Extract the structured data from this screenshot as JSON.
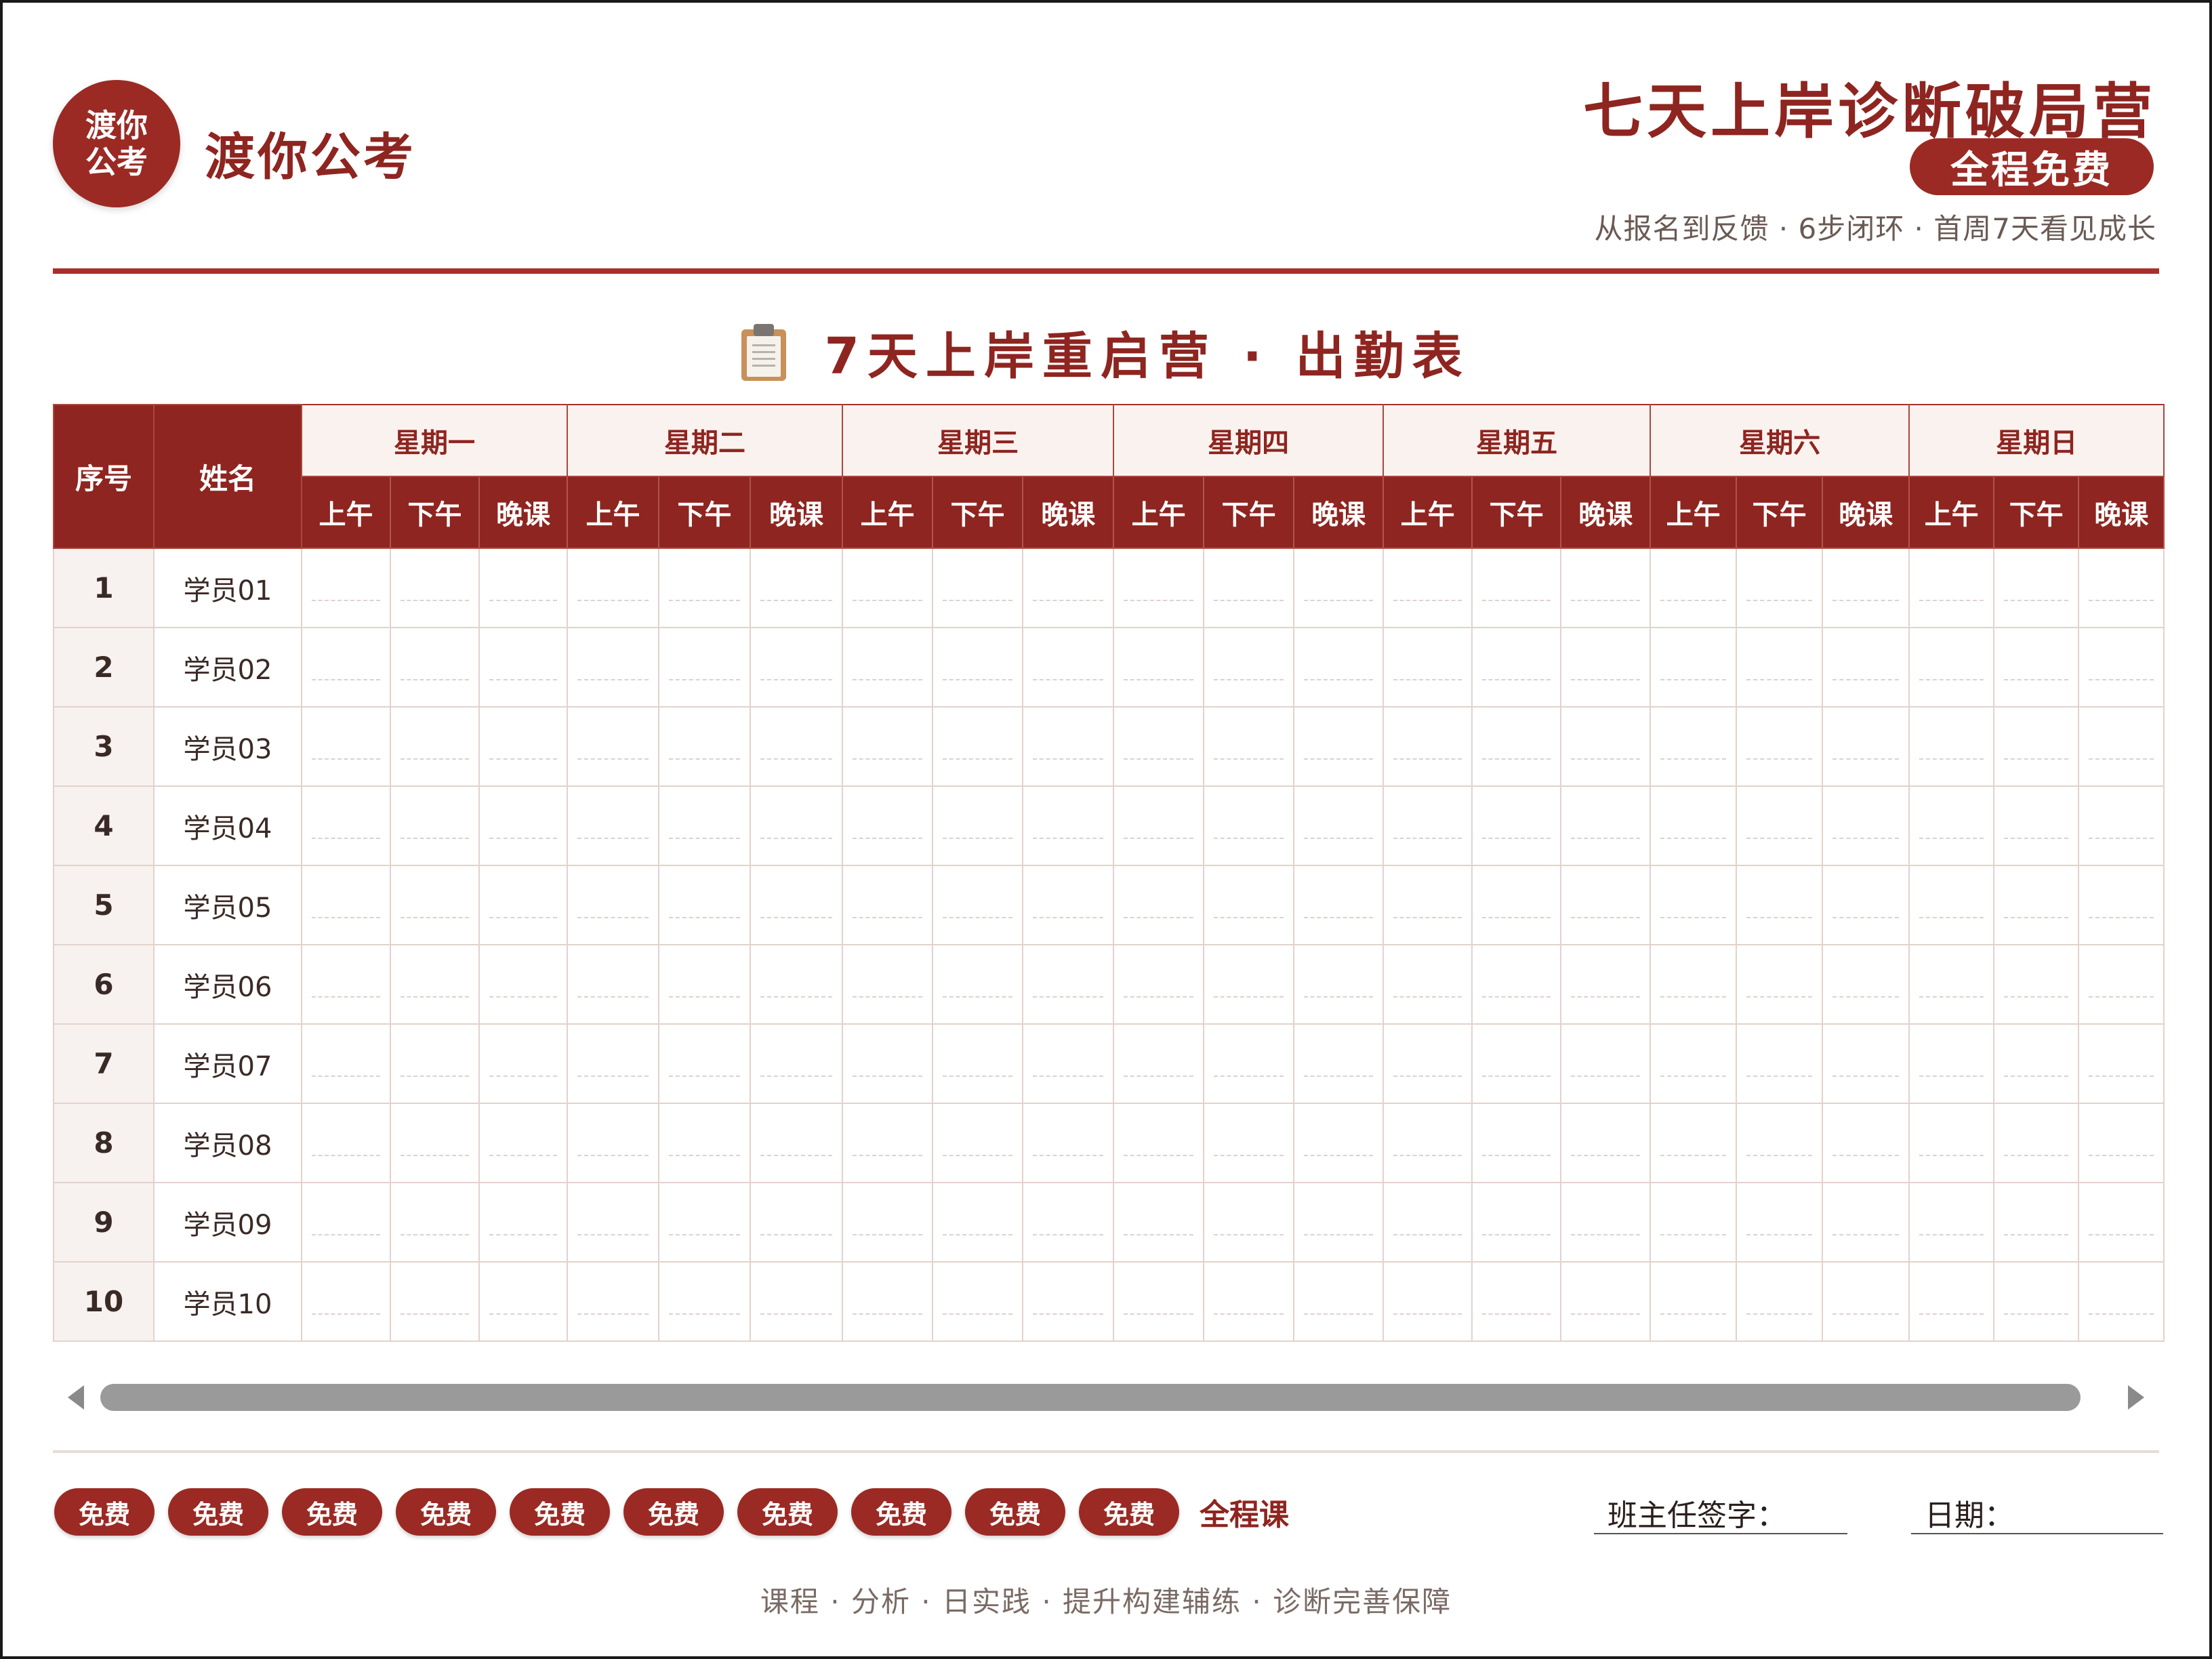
{
  "header": {
    "logo_text": "渡你公考",
    "brand_name": "渡你公考",
    "main_title": "七天上岸诊断破局营",
    "badge": "全程免费",
    "subtitle": "从报名到反馈 · 6步闭环 · 首周7天看见成长"
  },
  "section": {
    "icon": "clipboard-icon",
    "title": "7天上岸重启营 · 出勤表"
  },
  "table": {
    "col_index": "序号",
    "col_name": "姓名",
    "days": [
      "星期一",
      "星期二",
      "星期三",
      "星期四",
      "星期五",
      "星期六",
      "星期日"
    ],
    "slots": [
      "上午",
      "下午",
      "晚课"
    ],
    "rows": [
      {
        "idx": "1",
        "name": "学员01"
      },
      {
        "idx": "2",
        "name": "学员02"
      },
      {
        "idx": "3",
        "name": "学员03"
      },
      {
        "idx": "4",
        "name": "学员04"
      },
      {
        "idx": "5",
        "name": "学员05"
      },
      {
        "idx": "6",
        "name": "学员06"
      },
      {
        "idx": "7",
        "name": "学员07"
      },
      {
        "idx": "8",
        "name": "学员08"
      },
      {
        "idx": "9",
        "name": "学员09"
      },
      {
        "idx": "10",
        "name": "学员10"
      }
    ]
  },
  "footer": {
    "tags": [
      "免费",
      "免费",
      "免费",
      "免费",
      "免费",
      "免费",
      "免费",
      "免费",
      "免费",
      "免费"
    ],
    "tag_end": "全程课",
    "sign_label": "班主任签字：",
    "date_label": "日期：",
    "tagline": "课程 · 分析 · 日实践 · 提升构建辅练 · 诊断完善保障"
  },
  "colors": {
    "brand": "#8e2520",
    "accent": "#9b2a24",
    "rule": "#a8302a"
  }
}
